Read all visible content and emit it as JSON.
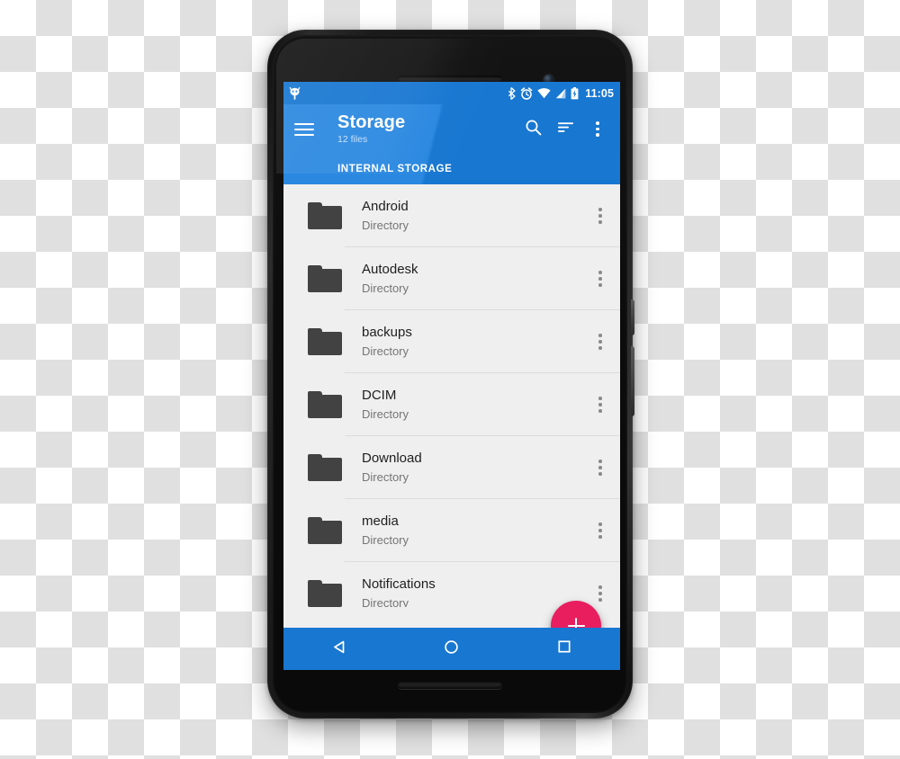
{
  "status_bar": {
    "notification_icon": "android-notification-icon",
    "icons": [
      "bluetooth-icon",
      "alarm-icon",
      "wifi-icon",
      "cell-signal-icon",
      "battery-charging-icon"
    ],
    "clock": "11:05"
  },
  "app_bar": {
    "menu_icon": "hamburger-menu-icon",
    "title": "Storage",
    "subtitle": "12 files",
    "actions": [
      {
        "name": "search-icon",
        "label": "Search"
      },
      {
        "name": "sort-icon",
        "label": "Sort"
      },
      {
        "name": "overflow-menu-icon",
        "label": "More options"
      }
    ],
    "breadcrumb": "INTERNAL STORAGE"
  },
  "file_list": {
    "items": [
      {
        "name": "Android",
        "type": "Directory",
        "icon": "folder-icon"
      },
      {
        "name": "Autodesk",
        "type": "Directory",
        "icon": "folder-icon"
      },
      {
        "name": "backups",
        "type": "Directory",
        "icon": "folder-icon"
      },
      {
        "name": "DCIM",
        "type": "Directory",
        "icon": "folder-icon"
      },
      {
        "name": "Download",
        "type": "Directory",
        "icon": "folder-icon"
      },
      {
        "name": "media",
        "type": "Directory",
        "icon": "folder-icon"
      },
      {
        "name": "Notifications",
        "type": "Directory",
        "icon": "folder-icon"
      }
    ]
  },
  "fab": {
    "icon": "plus-icon",
    "label": "Add",
    "color": "#e91e5f"
  },
  "nav_bar": {
    "buttons": [
      {
        "name": "nav-back-button",
        "label": "Back"
      },
      {
        "name": "nav-home-button",
        "label": "Home"
      },
      {
        "name": "nav-recents-button",
        "label": "Recents"
      }
    ],
    "color": "#1877d1"
  },
  "theme": {
    "primary": "#1877d1",
    "primary_light": "#2a88e0",
    "accent": "#e91e5f",
    "list_bg": "#efefef",
    "folder": "#424242"
  }
}
